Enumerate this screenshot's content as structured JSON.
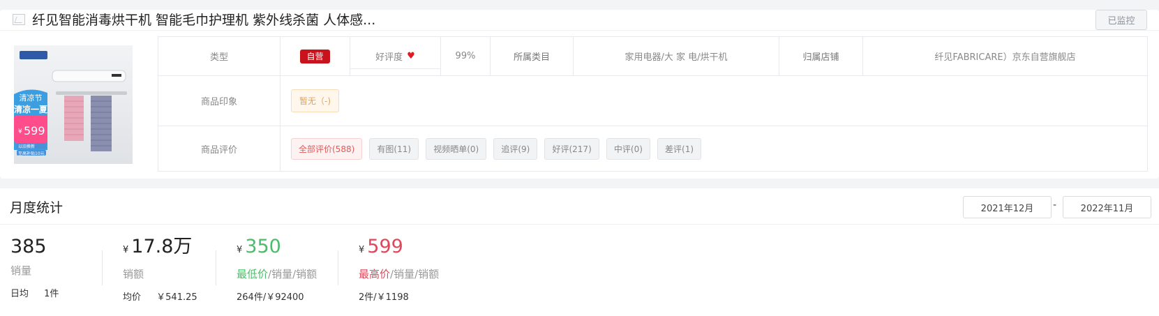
{
  "product": {
    "title": "纤见智能消毒烘干机 智能毛巾护理机 紫外线杀菌 人体感...",
    "monitor_button": "已监控",
    "image_text": {
      "badge": "清凉节",
      "headline": "清凉一夏",
      "price_symbol": "¥",
      "price": "599",
      "tag1": "以旧换新",
      "tag2": "至高补贴10元"
    }
  },
  "info": {
    "type_label": "类型",
    "type_value": "自营",
    "rating_label": "好评度",
    "rating_value": "99%",
    "category_label": "所属类目",
    "category_value": "家用电器/大 家 电/烘干机",
    "shop_label": "归属店铺",
    "shop_value": "纤见FABRICARE）京东自营旗舰店",
    "impression_label": "商品印象",
    "impression_value": "暂无（-)",
    "review_label": "商品评价",
    "review_tags": [
      "全部评价(588)",
      "有图(11)",
      "视频晒单(0)",
      "追评(9)",
      "好评(217)",
      "中评(0)",
      "差评(1)"
    ]
  },
  "monthly": {
    "title": "月度统计",
    "date_from": "2021年12月",
    "date_sep": "-",
    "date_to": "2022年11月",
    "sales": {
      "value": "385",
      "label": "销量",
      "daily_label": "日均",
      "daily_value": "1件"
    },
    "revenue": {
      "yen": "¥",
      "value": "17.8万",
      "label": "销额",
      "avg_label": "均价",
      "avg_value": "￥541.25"
    },
    "min_price": {
      "yen": "¥",
      "value": "350",
      "label_main": "最低价",
      "label_rest": "/销量/销额",
      "sub": "264件/￥92400"
    },
    "max_price": {
      "yen": "¥",
      "value": "599",
      "label_main": "最高价",
      "label_rest": "/销量/销额",
      "sub": "2件/￥1198"
    }
  },
  "colors": {
    "accent_red": "#c9131c",
    "green": "#4cbc6a",
    "red": "#e0475a"
  },
  "icons": [
    "image-placeholder-icon",
    "heart-icon"
  ]
}
